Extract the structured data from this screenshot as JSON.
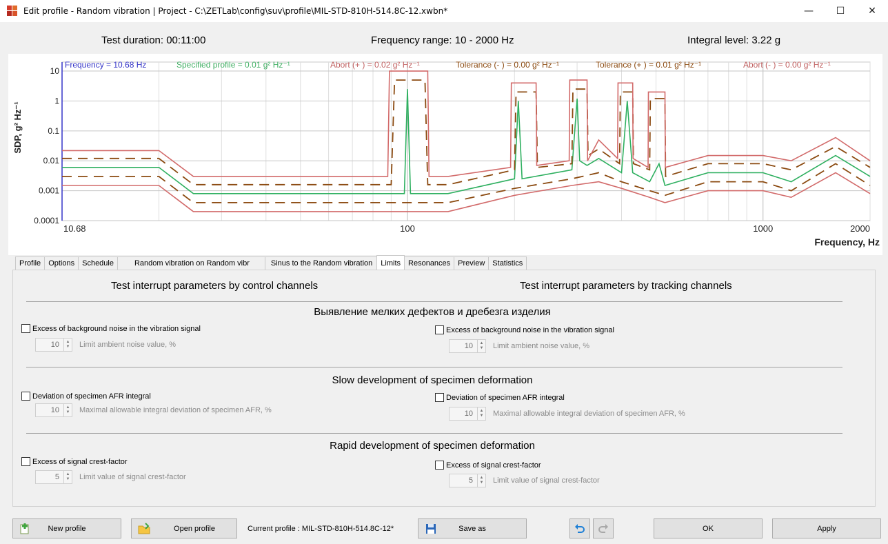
{
  "window": {
    "title": "Edit profile - Random vibration | Project - C:\\ZETLab\\config\\suv\\profile\\MIL-STD-810H-514.8C-12.xwbn*",
    "controls": [
      "—",
      "☐",
      "✕"
    ]
  },
  "summary": {
    "duration": "Test duration: 00:11:00",
    "freq_range": "Frequency range: 10 - 2000  Hz",
    "integral": "Integral level: 3.22 g"
  },
  "chart_data": {
    "type": "line",
    "title": "",
    "xlabel": "Frequency, Hz",
    "ylabel": "SDP, g² Hz⁻¹",
    "xscale": "log",
    "yscale": "log",
    "xlim": [
      10.68,
      2000
    ],
    "ylim": [
      0.0001,
      20
    ],
    "x_tick_labels": [
      "10.68",
      "100",
      "1000",
      "2000"
    ],
    "y_tick_labels": [
      "10",
      "1",
      "0.1",
      "0.01",
      "0.001",
      "0.0001"
    ],
    "grid": true,
    "legend_position": "top",
    "readouts": [
      {
        "text": "Frequency = 10.68 Hz",
        "color": "#3535c8"
      },
      {
        "text": "Specified profile  = 0.01 g² Hz⁻¹",
        "color": "#3fae62"
      },
      {
        "text": "Abort (+ )  = 0.02 g² Hz⁻¹",
        "color": "#c06060"
      },
      {
        "text": "Tolerance (- )  = 0.00 g² Hz⁻¹",
        "color": "#8b4a10"
      },
      {
        "text": "Tolerance (+ )  = 0.01 g² Hz⁻¹",
        "color": "#8b4a10"
      },
      {
        "text": "Abort (- )  = 0.00 g² Hz⁻¹",
        "color": "#c06060"
      }
    ],
    "series": [
      {
        "name": "Specified profile",
        "color": "#2fb060",
        "style": "solid",
        "points": [
          [
            10.68,
            0.006
          ],
          [
            20,
            0.006
          ],
          [
            25,
            0.0008
          ],
          [
            98,
            0.0008
          ],
          [
            100,
            2.5
          ],
          [
            102,
            0.0008
          ],
          [
            130,
            0.0008
          ],
          [
            200,
            0.0025
          ],
          [
            205,
            1.0
          ],
          [
            210,
            0.0025
          ],
          [
            290,
            0.005
          ],
          [
            300,
            1.2
          ],
          [
            305,
            0.01
          ],
          [
            320,
            0.007
          ],
          [
            345,
            0.012
          ],
          [
            400,
            0.004
          ],
          [
            415,
            1.0
          ],
          [
            430,
            0.004
          ],
          [
            480,
            0.002
          ],
          [
            510,
            0.008
          ],
          [
            530,
            0.0015
          ],
          [
            700,
            0.004
          ],
          [
            1000,
            0.004
          ],
          [
            1200,
            0.002
          ],
          [
            1600,
            0.015
          ],
          [
            2000,
            0.003
          ]
        ]
      },
      {
        "name": "Tolerance (+)",
        "color": "#8b4a10",
        "style": "dashed",
        "points": [
          [
            10.68,
            0.012
          ],
          [
            20,
            0.012
          ],
          [
            25,
            0.0016
          ],
          [
            90,
            0.0016
          ],
          [
            92,
            5
          ],
          [
            112,
            5
          ],
          [
            114,
            0.0016
          ],
          [
            130,
            0.0016
          ],
          [
            200,
            0.005
          ],
          [
            202,
            2
          ],
          [
            230,
            2
          ],
          [
            232,
            0.006
          ],
          [
            290,
            0.008
          ],
          [
            292,
            2.5
          ],
          [
            320,
            2.5
          ],
          [
            322,
            0.015
          ],
          [
            345,
            0.025
          ],
          [
            395,
            0.008
          ],
          [
            397,
            2
          ],
          [
            430,
            2
          ],
          [
            432,
            0.008
          ],
          [
            480,
            0.005
          ],
          [
            482,
            1.2
          ],
          [
            530,
            1.2
          ],
          [
            532,
            0.003
          ],
          [
            700,
            0.008
          ],
          [
            1000,
            0.008
          ],
          [
            1200,
            0.005
          ],
          [
            1600,
            0.03
          ],
          [
            2000,
            0.006
          ]
        ]
      },
      {
        "name": "Tolerance (-)",
        "color": "#8b4a10",
        "style": "dashed",
        "points": [
          [
            10.68,
            0.003
          ],
          [
            20,
            0.003
          ],
          [
            25,
            0.0004
          ],
          [
            130,
            0.0004
          ],
          [
            200,
            0.0012
          ],
          [
            290,
            0.0025
          ],
          [
            345,
            0.004
          ],
          [
            400,
            0.002
          ],
          [
            480,
            0.001
          ],
          [
            530,
            0.0007
          ],
          [
            700,
            0.002
          ],
          [
            1000,
            0.002
          ],
          [
            1200,
            0.001
          ],
          [
            1600,
            0.008
          ],
          [
            2000,
            0.0015
          ]
        ]
      },
      {
        "name": "Abort (+)",
        "color": "#d26a6a",
        "style": "solid",
        "points": [
          [
            10.68,
            0.022
          ],
          [
            20,
            0.022
          ],
          [
            25,
            0.003
          ],
          [
            88,
            0.003
          ],
          [
            89,
            10
          ],
          [
            114,
            10
          ],
          [
            115,
            0.003
          ],
          [
            130,
            0.003
          ],
          [
            195,
            0.006
          ],
          [
            196,
            4
          ],
          [
            230,
            4
          ],
          [
            231,
            0.007
          ],
          [
            285,
            0.01
          ],
          [
            286,
            5
          ],
          [
            320,
            5
          ],
          [
            321,
            0.01
          ],
          [
            345,
            0.05
          ],
          [
            390,
            0.012
          ],
          [
            391,
            4
          ],
          [
            430,
            4
          ],
          [
            431,
            0.012
          ],
          [
            475,
            0.006
          ],
          [
            476,
            2
          ],
          [
            530,
            2
          ],
          [
            531,
            0.006
          ],
          [
            700,
            0.015
          ],
          [
            1000,
            0.015
          ],
          [
            1200,
            0.01
          ],
          [
            1600,
            0.06
          ],
          [
            2000,
            0.01
          ]
        ]
      },
      {
        "name": "Abort (-)",
        "color": "#d26a6a",
        "style": "solid",
        "points": [
          [
            10.68,
            0.0015
          ],
          [
            20,
            0.0015
          ],
          [
            25,
            0.0002
          ],
          [
            130,
            0.0002
          ],
          [
            200,
            0.0007
          ],
          [
            290,
            0.0015
          ],
          [
            345,
            0.002
          ],
          [
            400,
            0.0012
          ],
          [
            480,
            0.0006
          ],
          [
            530,
            0.0004
          ],
          [
            700,
            0.001
          ],
          [
            1000,
            0.001
          ],
          [
            1200,
            0.0006
          ],
          [
            1600,
            0.004
          ],
          [
            2000,
            0.0008
          ]
        ]
      }
    ]
  },
  "tabs": [
    {
      "label": "Profile",
      "active": false
    },
    {
      "label": "Options",
      "active": false
    },
    {
      "label": "Schedule",
      "active": false
    },
    {
      "label": "Random vibration on Random vibr",
      "active": false
    },
    {
      "label": "Sinus to the Random vibration",
      "active": false
    },
    {
      "label": "Limits",
      "active": true
    },
    {
      "label": "Resonances",
      "active": false
    },
    {
      "label": "Preview",
      "active": false
    },
    {
      "label": "Statistics",
      "active": false
    }
  ],
  "limits": {
    "control_header": "Test interrupt parameters by control channels",
    "tracking_header": "Test interrupt parameters by tracking channels",
    "sections": [
      {
        "title": "Выявление мелких дефектов и дребезга изделия",
        "check_label": "Excess of background noise in the vibration signal",
        "spin_value": "10",
        "spin_label": "Limit ambient noise value, %"
      },
      {
        "title": "Slow development of specimen deformation",
        "check_label": "Deviation of specimen AFR integral",
        "spin_value": "10",
        "spin_label": "Maximal allowable integral deviation of specimen AFR, %"
      },
      {
        "title": "Rapid development of specimen deformation",
        "check_label": "Excess of signal crest-factor",
        "spin_value": "5",
        "spin_label": "Limit value of signal crest-factor"
      }
    ]
  },
  "bottom": {
    "new_profile": "New profile",
    "open_profile": "Open profile",
    "current_profile": "Current profile : MIL-STD-810H-514.8C-12*",
    "save_as": "Save as",
    "ok": "OK",
    "apply": "Apply"
  }
}
